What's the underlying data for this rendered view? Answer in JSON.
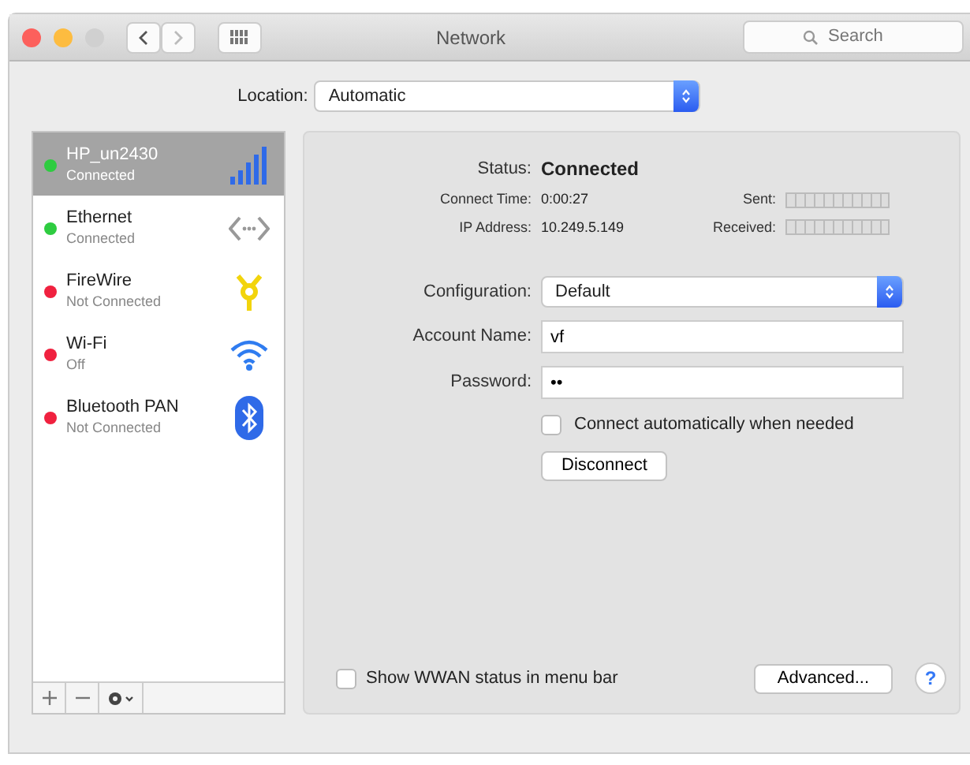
{
  "window": {
    "title": "Network"
  },
  "toolbar": {
    "search": {
      "placeholder": "Search"
    }
  },
  "location": {
    "label": "Location:",
    "value": "Automatic"
  },
  "services": [
    {
      "name": "HP_un2430",
      "status": "Connected",
      "color": "#2ecc40",
      "kind": "cellular",
      "selected": true
    },
    {
      "name": "Ethernet",
      "status": "Connected",
      "color": "#2ecc40",
      "kind": "ethernet",
      "selected": false
    },
    {
      "name": "FireWire",
      "status": "Not Connected",
      "color": "#f0213f",
      "kind": "firewire",
      "selected": false
    },
    {
      "name": "Wi-Fi",
      "status": "Off",
      "color": "#f0213f",
      "kind": "wifi",
      "selected": false
    },
    {
      "name": "Bluetooth PAN",
      "status": "Not Connected",
      "color": "#f0213f",
      "kind": "bluetooth",
      "selected": false
    }
  ],
  "details": {
    "status_label": "Status:",
    "status": "Connected",
    "connect_time_label": "Connect Time:",
    "connect_time": "0:00:27",
    "sent_label": "Sent:",
    "ip_label": "IP Address:",
    "ip": "10.249.5.149",
    "received_label": "Received:",
    "configuration_label": "Configuration:",
    "configuration": "Default",
    "account_label": "Account Name:",
    "account": "vf",
    "password_label": "Password:",
    "password": "••",
    "auto_connect": {
      "label": "Connect automatically when needed",
      "checked": false
    },
    "disconnect": "Disconnect"
  },
  "footer": {
    "show_status": {
      "label": "Show WWAN status in menu bar",
      "checked": false
    },
    "advanced": "Advanced...",
    "help": "?"
  }
}
